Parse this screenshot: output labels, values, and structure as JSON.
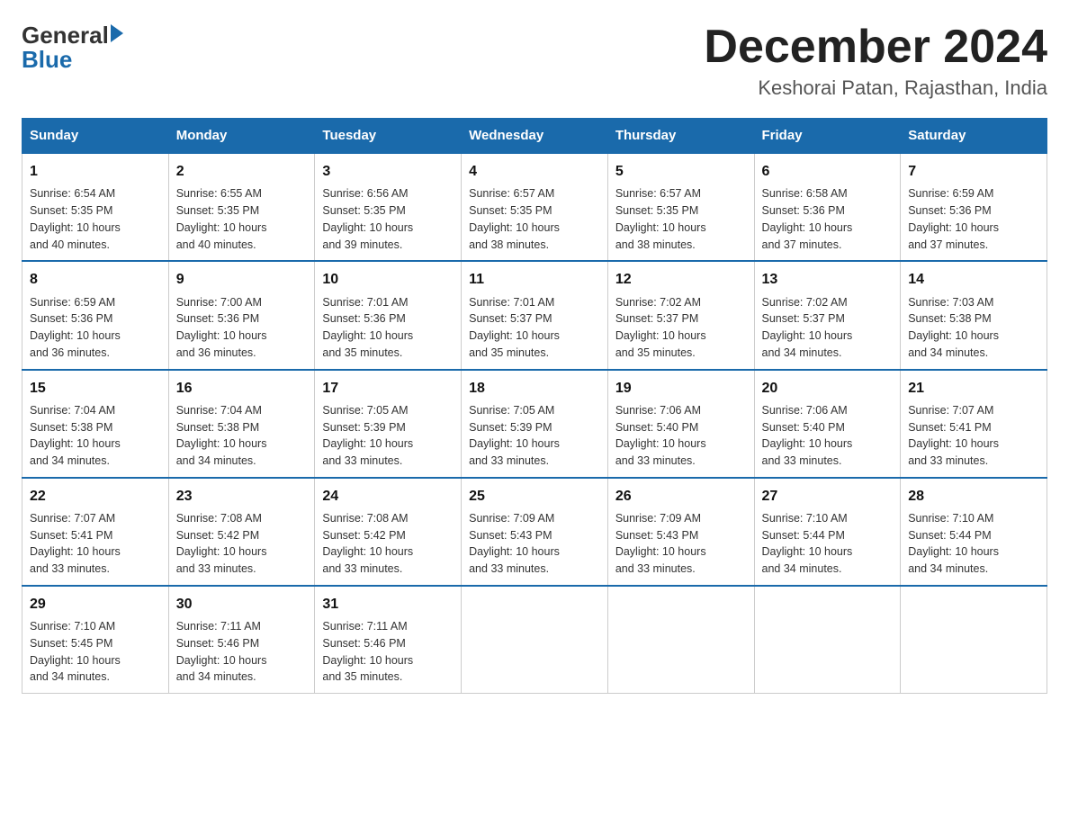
{
  "header": {
    "logo_general": "General",
    "logo_blue": "Blue",
    "month_title": "December 2024",
    "location": "Keshorai Patan, Rajasthan, India"
  },
  "days_of_week": [
    "Sunday",
    "Monday",
    "Tuesday",
    "Wednesday",
    "Thursday",
    "Friday",
    "Saturday"
  ],
  "weeks": [
    [
      {
        "day": "1",
        "sunrise": "6:54 AM",
        "sunset": "5:35 PM",
        "daylight": "10 hours and 40 minutes."
      },
      {
        "day": "2",
        "sunrise": "6:55 AM",
        "sunset": "5:35 PM",
        "daylight": "10 hours and 40 minutes."
      },
      {
        "day": "3",
        "sunrise": "6:56 AM",
        "sunset": "5:35 PM",
        "daylight": "10 hours and 39 minutes."
      },
      {
        "day": "4",
        "sunrise": "6:57 AM",
        "sunset": "5:35 PM",
        "daylight": "10 hours and 38 minutes."
      },
      {
        "day": "5",
        "sunrise": "6:57 AM",
        "sunset": "5:35 PM",
        "daylight": "10 hours and 38 minutes."
      },
      {
        "day": "6",
        "sunrise": "6:58 AM",
        "sunset": "5:36 PM",
        "daylight": "10 hours and 37 minutes."
      },
      {
        "day": "7",
        "sunrise": "6:59 AM",
        "sunset": "5:36 PM",
        "daylight": "10 hours and 37 minutes."
      }
    ],
    [
      {
        "day": "8",
        "sunrise": "6:59 AM",
        "sunset": "5:36 PM",
        "daylight": "10 hours and 36 minutes."
      },
      {
        "day": "9",
        "sunrise": "7:00 AM",
        "sunset": "5:36 PM",
        "daylight": "10 hours and 36 minutes."
      },
      {
        "day": "10",
        "sunrise": "7:01 AM",
        "sunset": "5:36 PM",
        "daylight": "10 hours and 35 minutes."
      },
      {
        "day": "11",
        "sunrise": "7:01 AM",
        "sunset": "5:37 PM",
        "daylight": "10 hours and 35 minutes."
      },
      {
        "day": "12",
        "sunrise": "7:02 AM",
        "sunset": "5:37 PM",
        "daylight": "10 hours and 35 minutes."
      },
      {
        "day": "13",
        "sunrise": "7:02 AM",
        "sunset": "5:37 PM",
        "daylight": "10 hours and 34 minutes."
      },
      {
        "day": "14",
        "sunrise": "7:03 AM",
        "sunset": "5:38 PM",
        "daylight": "10 hours and 34 minutes."
      }
    ],
    [
      {
        "day": "15",
        "sunrise": "7:04 AM",
        "sunset": "5:38 PM",
        "daylight": "10 hours and 34 minutes."
      },
      {
        "day": "16",
        "sunrise": "7:04 AM",
        "sunset": "5:38 PM",
        "daylight": "10 hours and 34 minutes."
      },
      {
        "day": "17",
        "sunrise": "7:05 AM",
        "sunset": "5:39 PM",
        "daylight": "10 hours and 33 minutes."
      },
      {
        "day": "18",
        "sunrise": "7:05 AM",
        "sunset": "5:39 PM",
        "daylight": "10 hours and 33 minutes."
      },
      {
        "day": "19",
        "sunrise": "7:06 AM",
        "sunset": "5:40 PM",
        "daylight": "10 hours and 33 minutes."
      },
      {
        "day": "20",
        "sunrise": "7:06 AM",
        "sunset": "5:40 PM",
        "daylight": "10 hours and 33 minutes."
      },
      {
        "day": "21",
        "sunrise": "7:07 AM",
        "sunset": "5:41 PM",
        "daylight": "10 hours and 33 minutes."
      }
    ],
    [
      {
        "day": "22",
        "sunrise": "7:07 AM",
        "sunset": "5:41 PM",
        "daylight": "10 hours and 33 minutes."
      },
      {
        "day": "23",
        "sunrise": "7:08 AM",
        "sunset": "5:42 PM",
        "daylight": "10 hours and 33 minutes."
      },
      {
        "day": "24",
        "sunrise": "7:08 AM",
        "sunset": "5:42 PM",
        "daylight": "10 hours and 33 minutes."
      },
      {
        "day": "25",
        "sunrise": "7:09 AM",
        "sunset": "5:43 PM",
        "daylight": "10 hours and 33 minutes."
      },
      {
        "day": "26",
        "sunrise": "7:09 AM",
        "sunset": "5:43 PM",
        "daylight": "10 hours and 33 minutes."
      },
      {
        "day": "27",
        "sunrise": "7:10 AM",
        "sunset": "5:44 PM",
        "daylight": "10 hours and 34 minutes."
      },
      {
        "day": "28",
        "sunrise": "7:10 AM",
        "sunset": "5:44 PM",
        "daylight": "10 hours and 34 minutes."
      }
    ],
    [
      {
        "day": "29",
        "sunrise": "7:10 AM",
        "sunset": "5:45 PM",
        "daylight": "10 hours and 34 minutes."
      },
      {
        "day": "30",
        "sunrise": "7:11 AM",
        "sunset": "5:46 PM",
        "daylight": "10 hours and 34 minutes."
      },
      {
        "day": "31",
        "sunrise": "7:11 AM",
        "sunset": "5:46 PM",
        "daylight": "10 hours and 35 minutes."
      },
      null,
      null,
      null,
      null
    ]
  ],
  "labels": {
    "sunrise": "Sunrise:",
    "sunset": "Sunset:",
    "daylight": "Daylight:"
  }
}
